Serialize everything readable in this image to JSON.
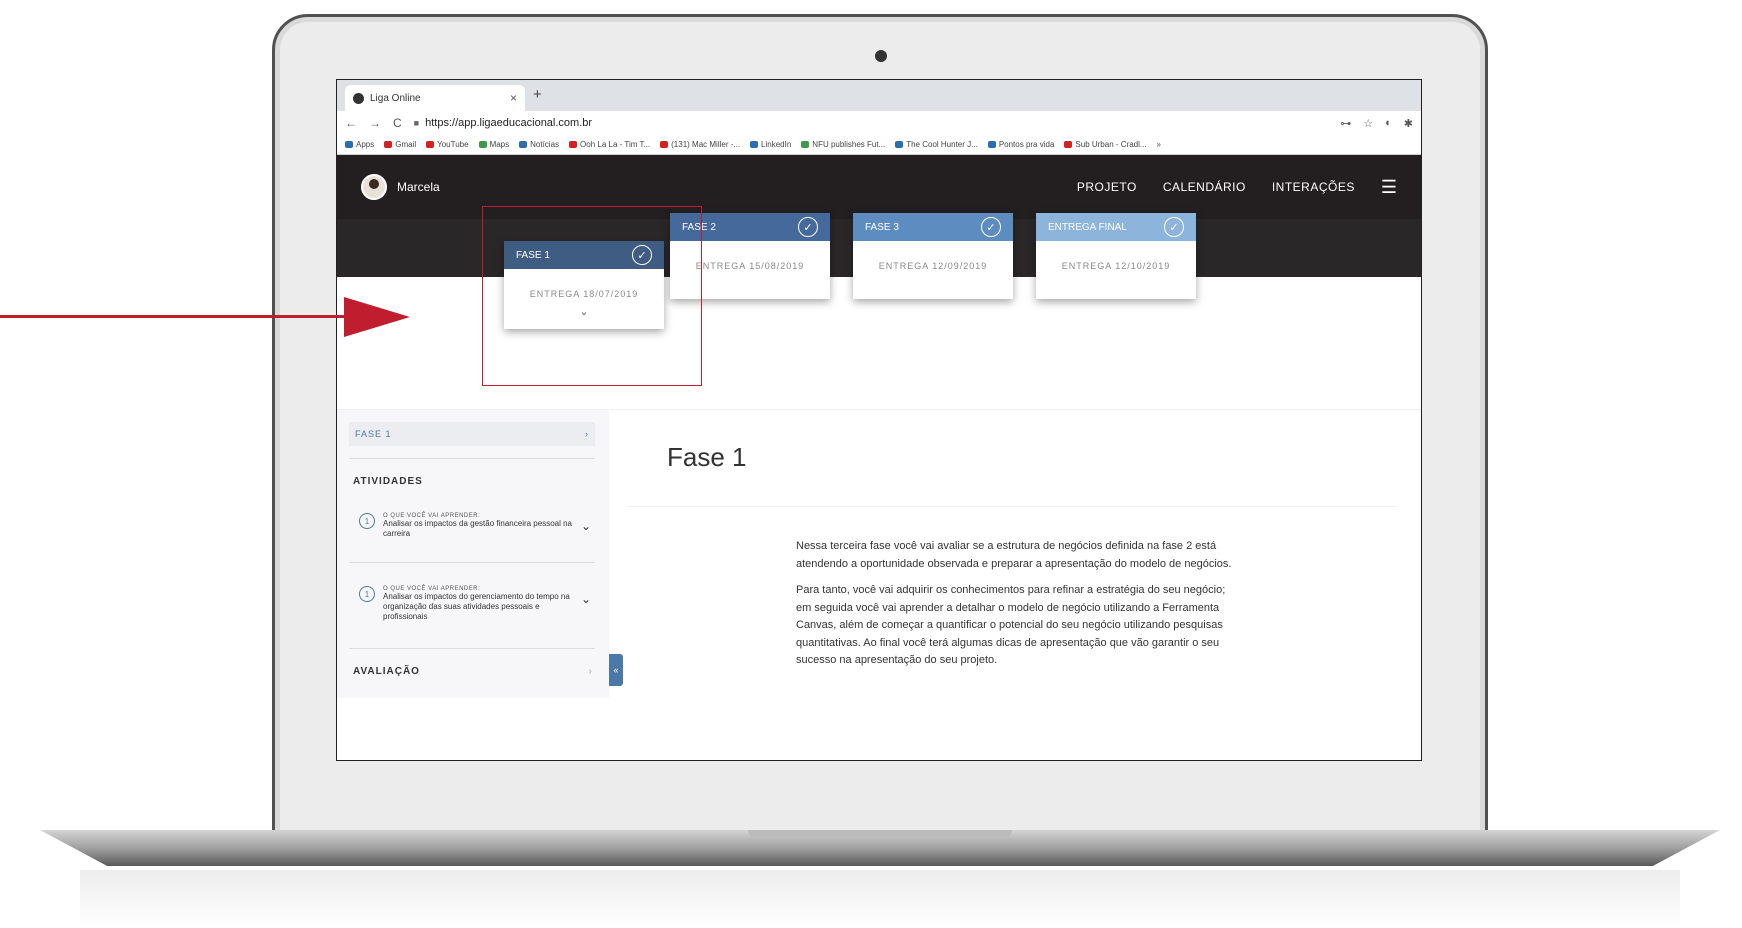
{
  "browser": {
    "tab_title": "Liga Online",
    "tab_close": "×",
    "new_tab": "+",
    "back": "←",
    "forward": "→",
    "reload": "C",
    "url": "https://app.ligaeducacional.com.br",
    "key_icon": "⊶",
    "star_icon": "☆",
    "extension_icon": "◐",
    "puzzle_icon": "✱",
    "bookmarks": [
      {
        "label": "Apps",
        "color": "blue"
      },
      {
        "label": "Gmail",
        "color": "red"
      },
      {
        "label": "YouTube",
        "color": "red"
      },
      {
        "label": "Maps",
        "color": "green"
      },
      {
        "label": "Notícias",
        "color": "blue"
      },
      {
        "label": "Ooh La La - Tim T...",
        "color": "red"
      },
      {
        "label": "(131) Mac Miller -...",
        "color": "red"
      },
      {
        "label": "LinkedIn",
        "color": "blue"
      },
      {
        "label": "NFU publishes Fut...",
        "color": "green"
      },
      {
        "label": "The Cool Hunter J...",
        "color": "blue"
      },
      {
        "label": "Pontos pra vida",
        "color": "blue"
      },
      {
        "label": "Sub Urban - Cradl...",
        "color": "red"
      }
    ],
    "bookmarks_more": "»"
  },
  "header": {
    "user_name": "Marcela",
    "nav": [
      "PROJETO",
      "CALENDÁRIO",
      "INTERAÇÕES"
    ],
    "menu_icon": "☰"
  },
  "phases": [
    {
      "label": "FASE 1",
      "due": "ENTREGA 18/07/2019",
      "color": "#3f5d82",
      "check": "✓",
      "chevron": "⌄"
    },
    {
      "label": "FASE 2",
      "due": "ENTREGA 15/08/2019",
      "color": "#44699a",
      "check": "✓"
    },
    {
      "label": "FASE 3",
      "due": "ENTREGA 12/09/2019",
      "color": "#5d8cc0",
      "check": "✓"
    },
    {
      "label": "ENTREGA FINAL",
      "due": "ENTREGA 12/10/2019",
      "color": "#8db4da",
      "check": "✓"
    }
  ],
  "sidebar": {
    "phase_label": "FASE 1",
    "phase_chevron": "›",
    "activities_title": "ATIVIDADES",
    "activities": [
      {
        "num": "1",
        "kicker": "O QUE VOCÊ VAI APRENDER:",
        "text": "Analisar os impactos da gestão financeira pessoal na carreira",
        "chevron": "⌄"
      },
      {
        "num": "1",
        "kicker": "O QUE VOCÊ VAI APRENDER:",
        "text": "Analisar os impactos do gerenciamento do tempo na organização das suas atividades pessoais e profissionais",
        "chevron": "⌄"
      }
    ],
    "evaluation_title": "AVALIAÇÃO",
    "evaluation_chevron": "›",
    "collapse_icon": "«"
  },
  "main": {
    "title": "Fase 1",
    "paragraphs": [
      "Nessa terceira fase você vai avaliar se a estrutura de negócios definida na fase 2 está atendendo a oportunidade observada e preparar a apresentação do modelo de negócios.",
      "Para tanto, você vai adquirir os conhecimentos para refinar a estratégia do seu negócio; em seguida você vai aprender a detalhar o modelo de negócio utilizando a Ferramenta Canvas, além de começar a quantificar o potencial do seu negócio utilizando pesquisas quantitativas. Ao final você terá algumas dicas de apresentação que vão garantir o seu sucesso na apresentação do seu projeto."
    ]
  },
  "annotation": {
    "color": "#c01d2e"
  }
}
